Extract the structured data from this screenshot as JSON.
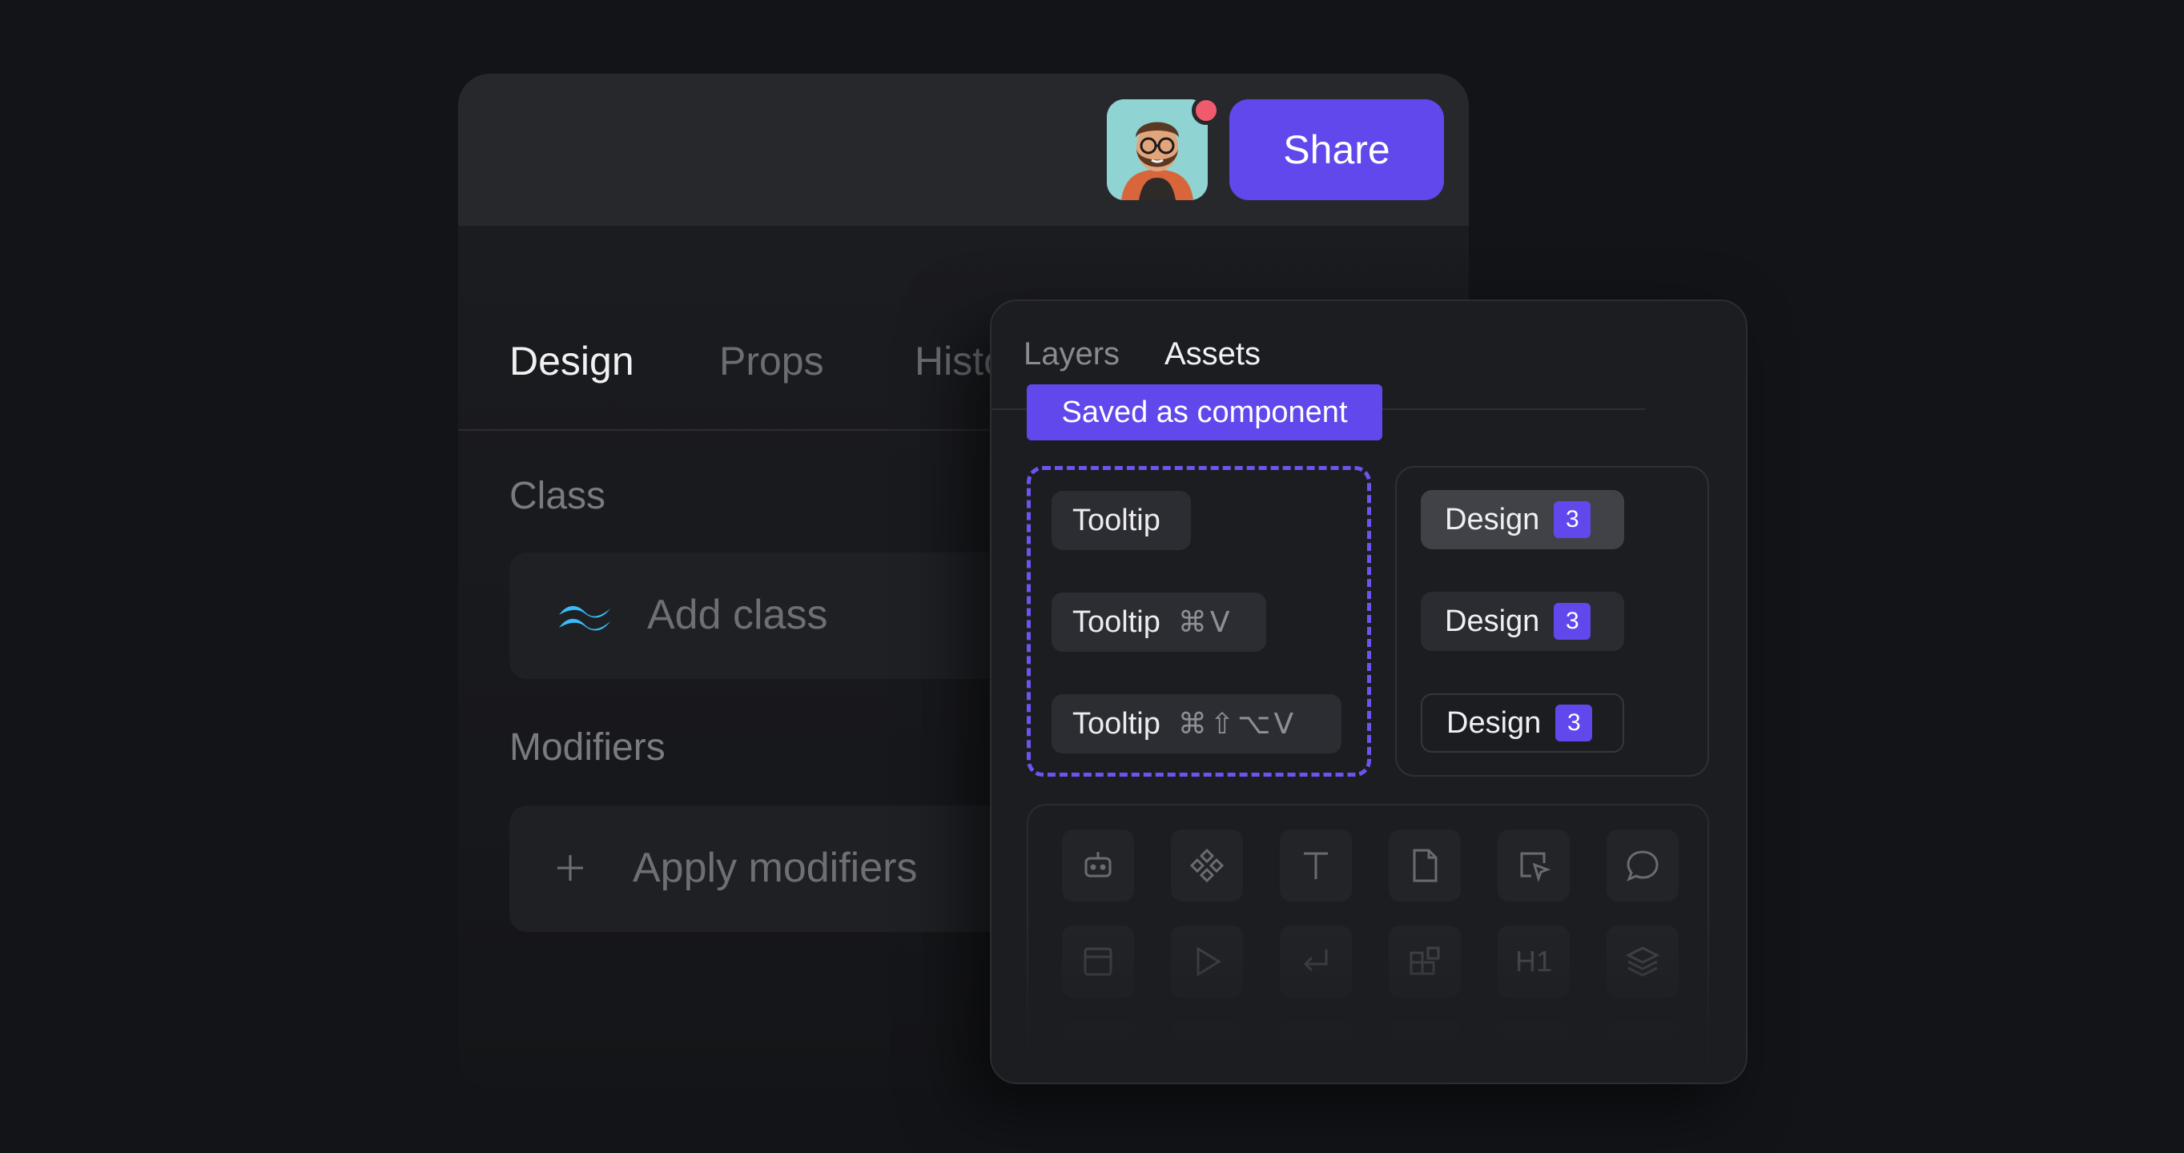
{
  "header": {
    "share_label": "Share",
    "avatar_icon": "user-avatar",
    "notification_color": "#ef5a6c",
    "accent_color": "#6048ec"
  },
  "tabs": [
    {
      "label": "Design",
      "active": true
    },
    {
      "label": "Props",
      "active": false
    },
    {
      "label": "History",
      "active": false
    }
  ],
  "class_section": {
    "label": "Class",
    "placeholder": "Add class",
    "icon": "tailwind-icon"
  },
  "modifiers_section": {
    "label": "Modifiers",
    "placeholder": "Apply modifiers",
    "icon": "plus-icon"
  },
  "assets_panel": {
    "tabs": [
      {
        "label": "Layers",
        "active": false
      },
      {
        "label": "Assets",
        "active": true
      }
    ],
    "saved_badge": "Saved as component",
    "tooltips": [
      {
        "label": "Tooltip",
        "shortcut": ""
      },
      {
        "label": "Tooltip",
        "shortcut": "⌘V"
      },
      {
        "label": "Tooltip",
        "shortcut": "⌘⇧⌥V"
      }
    ],
    "design_chips": [
      {
        "label": "Design",
        "count": "3"
      },
      {
        "label": "Design",
        "count": "3"
      },
      {
        "label": "Design",
        "count": "3"
      }
    ],
    "icon_grid": {
      "h1_label": "H1",
      "icons": [
        "robot-icon",
        "component-icon",
        "text-icon",
        "file-icon",
        "cursor-select-icon",
        "comment-icon",
        "layout-icon",
        "play-icon",
        "enter-icon",
        "add-component-icon",
        "heading-icon",
        "layers-icon"
      ]
    }
  }
}
